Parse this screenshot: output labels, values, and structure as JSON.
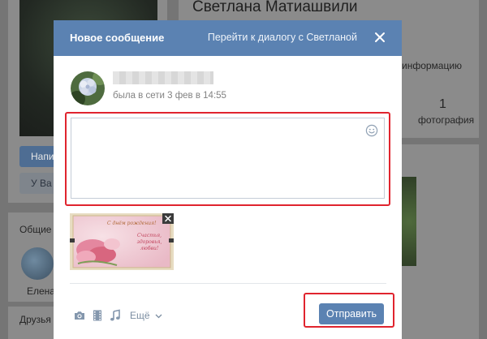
{
  "background": {
    "profile_name": "Светлана Матиашвили",
    "write_button_label": "Напи",
    "friends_button_label": "У Ва",
    "info_text": "информацию",
    "photos_count": "1",
    "photos_label": "фотография",
    "common_friends_label": "Общие д",
    "friend_name": "Елена",
    "friends_label": "Друзья"
  },
  "modal": {
    "title": "Новое сообщение",
    "goto_dialog_link": "Перейти к диалогу с Светланой",
    "close_icon": "close-icon",
    "recipient_status": "была в сети 3 фев в 14:55",
    "message_value": "",
    "emoji_icon": "smile-icon",
    "attachment": {
      "card_text_top": "С днём рождения!",
      "card_text_body": "Счастья, здоровья, любви!"
    },
    "toolbar": {
      "photo_icon": "camera-icon",
      "video_icon": "film-icon",
      "audio_icon": "music-note-icon",
      "more_label": "Ещё"
    },
    "send_label": "Отправить"
  },
  "colors": {
    "header_blue": "#5b82b2",
    "highlight_red": "#e0242e",
    "status_gray": "#828282"
  }
}
